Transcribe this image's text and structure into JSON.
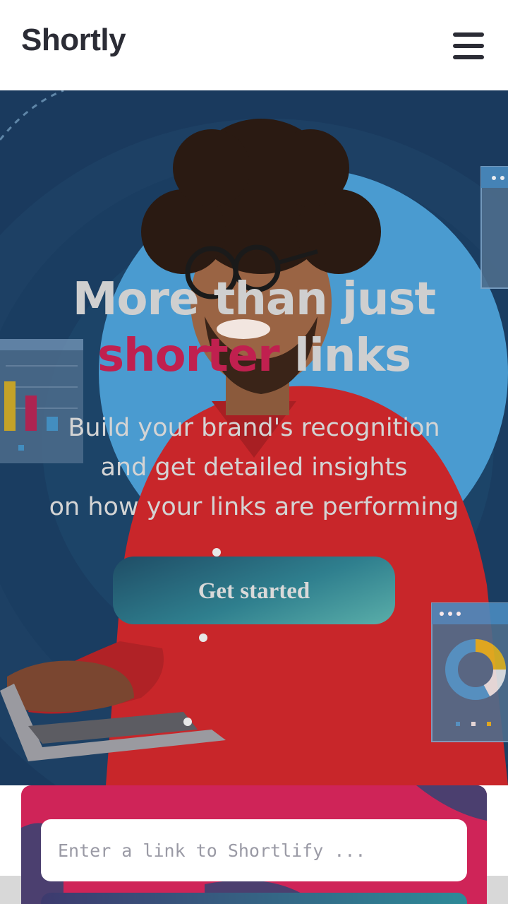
{
  "header": {
    "logo": "Shortly",
    "menu_icon": "hamburger-menu-icon"
  },
  "hero": {
    "title_line1": "More than just",
    "title_accent": "shorter",
    "title_rest": " links",
    "subtitle_line1": "Build your brand's recognition",
    "subtitle_line2": "and get detailed insights",
    "subtitle_line3": "on how your links are performing",
    "cta_label": "Get started"
  },
  "shorten": {
    "input_placeholder": "Enter a link to Shortlify ...",
    "input_value": ""
  },
  "colors": {
    "dark": "#2b2c35",
    "accent": "#c0204f",
    "hero_bg": "#1a3a5e",
    "shirt": "#c8262a",
    "cta_start": "#1f4d66",
    "cta_end": "#5aaea9"
  }
}
